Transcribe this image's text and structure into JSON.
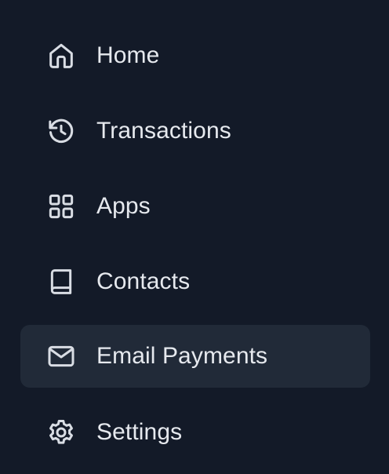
{
  "sidebar": {
    "items": [
      {
        "label": "Home",
        "icon": "home-icon",
        "active": false
      },
      {
        "label": "Transactions",
        "icon": "history-icon",
        "active": false
      },
      {
        "label": "Apps",
        "icon": "grid-icon",
        "active": false
      },
      {
        "label": "Contacts",
        "icon": "book-icon",
        "active": false
      },
      {
        "label": "Email Payments",
        "icon": "mail-icon",
        "active": true
      },
      {
        "label": "Settings",
        "icon": "gear-icon",
        "active": false
      }
    ]
  },
  "colors": {
    "background": "#131a28",
    "active_item_background": "#212a38",
    "text": "#e6e9ee",
    "icon_stroke": "#d9dde4"
  }
}
